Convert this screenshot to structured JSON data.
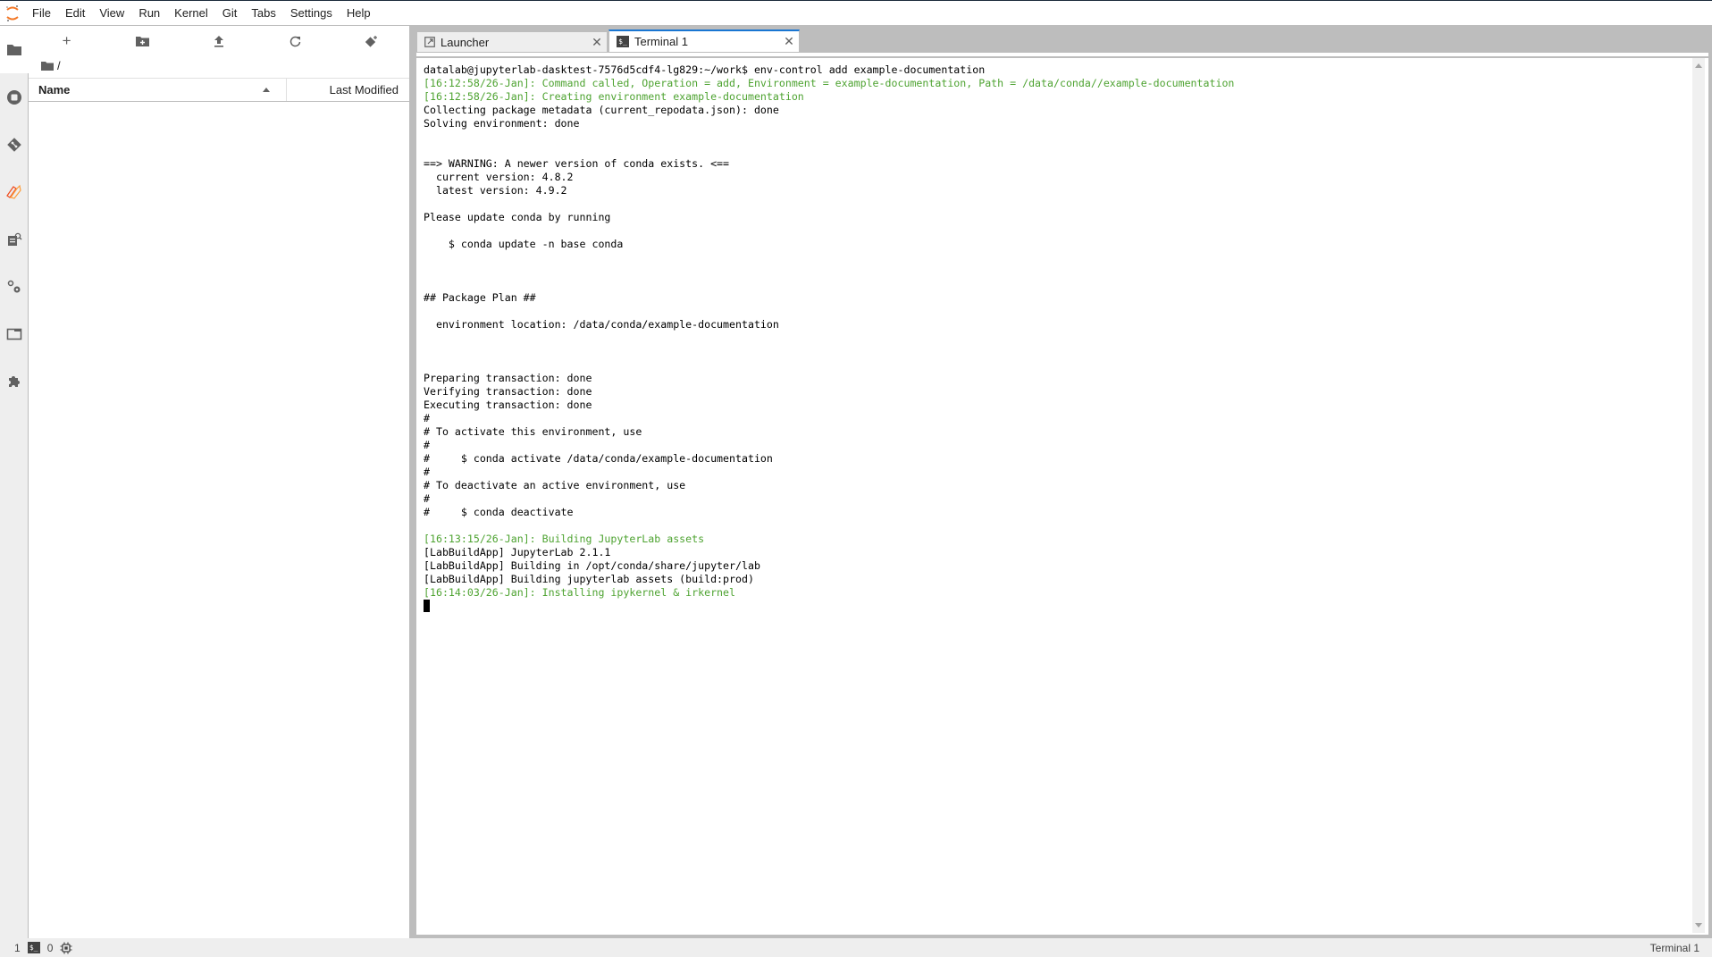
{
  "app": {
    "name": "JupyterLab",
    "accent_color": "#1976d2",
    "logo_color": "#f37726"
  },
  "menu": [
    "File",
    "Edit",
    "View",
    "Run",
    "Kernel",
    "Git",
    "Tabs",
    "Settings",
    "Help"
  ],
  "sidebar": {
    "tabs": [
      {
        "name": "file-browser",
        "icon": "folder-icon",
        "active": true
      },
      {
        "name": "running-sessions",
        "icon": "stop-circle-icon",
        "active": false
      },
      {
        "name": "git",
        "icon": "git-icon",
        "active": false
      },
      {
        "name": "dask",
        "icon": "dask-icon",
        "active": false
      },
      {
        "name": "property-inspector",
        "icon": "property-inspector-icon",
        "active": false
      },
      {
        "name": "commands",
        "icon": "gears-icon",
        "active": false
      },
      {
        "name": "open-tabs",
        "icon": "tab-icon",
        "active": false
      },
      {
        "name": "extension-manager",
        "icon": "puzzle-icon",
        "active": false
      }
    ]
  },
  "file_browser": {
    "toolbar": [
      {
        "name": "new-launcher",
        "icon": "plus-icon"
      },
      {
        "name": "new-folder",
        "icon": "new-folder-icon"
      },
      {
        "name": "upload",
        "icon": "upload-icon"
      },
      {
        "name": "refresh",
        "icon": "refresh-icon"
      },
      {
        "name": "git-clone",
        "icon": "git-clone-icon"
      }
    ],
    "breadcrumb": "/",
    "columns": {
      "name": "Name",
      "modified": "Last Modified"
    },
    "sort_indicator": "ascending",
    "items": []
  },
  "tabs": [
    {
      "label": "Launcher",
      "icon": "launcher-icon",
      "active": false
    },
    {
      "label": "Terminal 1",
      "icon": "terminal-icon",
      "active": true
    }
  ],
  "terminal": {
    "text_color": "#000000",
    "highlight_color": "#4ea331",
    "lines": [
      {
        "text": "datalab@jupyterlab-dasktest-7576d5cdf4-lg829:~/work$ env-control add example-documentation",
        "style": "normal"
      },
      {
        "text": "[16:12:58/26-Jan]: Command called, Operation = add, Environment = example-documentation, Path = /data/conda//example-documentation",
        "style": "green"
      },
      {
        "text": "[16:12:58/26-Jan]: Creating environment example-documentation",
        "style": "green"
      },
      {
        "text": "Collecting package metadata (current_repodata.json): done",
        "style": "normal"
      },
      {
        "text": "Solving environment: done",
        "style": "normal"
      },
      {
        "text": "",
        "style": "normal"
      },
      {
        "text": "",
        "style": "normal"
      },
      {
        "text": "==> WARNING: A newer version of conda exists. <==",
        "style": "normal"
      },
      {
        "text": "  current version: 4.8.2",
        "style": "normal"
      },
      {
        "text": "  latest version: 4.9.2",
        "style": "normal"
      },
      {
        "text": "",
        "style": "normal"
      },
      {
        "text": "Please update conda by running",
        "style": "normal"
      },
      {
        "text": "",
        "style": "normal"
      },
      {
        "text": "    $ conda update -n base conda",
        "style": "normal"
      },
      {
        "text": "",
        "style": "normal"
      },
      {
        "text": "",
        "style": "normal"
      },
      {
        "text": "",
        "style": "normal"
      },
      {
        "text": "## Package Plan ##",
        "style": "normal"
      },
      {
        "text": "",
        "style": "normal"
      },
      {
        "text": "  environment location: /data/conda/example-documentation",
        "style": "normal"
      },
      {
        "text": "",
        "style": "normal"
      },
      {
        "text": "",
        "style": "normal"
      },
      {
        "text": "",
        "style": "normal"
      },
      {
        "text": "Preparing transaction: done",
        "style": "normal"
      },
      {
        "text": "Verifying transaction: done",
        "style": "normal"
      },
      {
        "text": "Executing transaction: done",
        "style": "normal"
      },
      {
        "text": "#",
        "style": "normal"
      },
      {
        "text": "# To activate this environment, use",
        "style": "normal"
      },
      {
        "text": "#",
        "style": "normal"
      },
      {
        "text": "#     $ conda activate /data/conda/example-documentation",
        "style": "normal"
      },
      {
        "text": "#",
        "style": "normal"
      },
      {
        "text": "# To deactivate an active environment, use",
        "style": "normal"
      },
      {
        "text": "#",
        "style": "normal"
      },
      {
        "text": "#     $ conda deactivate",
        "style": "normal"
      },
      {
        "text": "",
        "style": "normal"
      },
      {
        "text": "[16:13:15/26-Jan]: Building JupyterLab assets",
        "style": "green"
      },
      {
        "text": "[LabBuildApp] JupyterLab 2.1.1",
        "style": "normal"
      },
      {
        "text": "[LabBuildApp] Building in /opt/conda/share/jupyter/lab",
        "style": "normal"
      },
      {
        "text": "[LabBuildApp] Building jupyterlab assets (build:prod)",
        "style": "normal"
      },
      {
        "text": "[16:14:03/26-Jan]: Installing ipykernel & irkernel",
        "style": "green"
      }
    ]
  },
  "status_bar": {
    "terminals_count": "1",
    "terminal_badge": "$_",
    "kernels_count": "0",
    "kernel_icon": "cpu-icon",
    "active_document": "Terminal 1"
  }
}
